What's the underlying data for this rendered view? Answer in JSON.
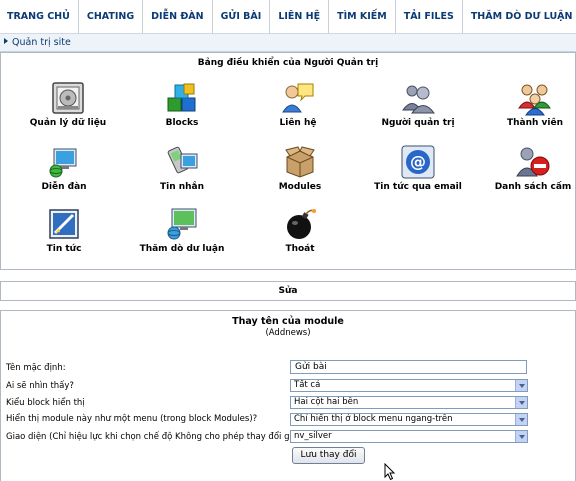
{
  "nav": {
    "items": [
      {
        "label": "TRANG CHỦ"
      },
      {
        "label": "CHATING"
      },
      {
        "label": "DIỄN ĐÀN"
      },
      {
        "label": "GỬI BÀI"
      },
      {
        "label": "LIÊN HỆ"
      },
      {
        "label": "TÌM KIẾM"
      },
      {
        "label": "TẢI FILES"
      },
      {
        "label": "THĂM DÒ DƯ LUẬN"
      }
    ]
  },
  "breadcrumb": {
    "label": "Quản trị site"
  },
  "panel": {
    "title": "Bảng điều khiển của Người Quản trị",
    "icons": [
      {
        "label": "Quản lý dữ liệu",
        "icon": "database-icon"
      },
      {
        "label": "Blocks",
        "icon": "blocks-icon"
      },
      {
        "label": "Liên hệ",
        "icon": "contact-icon"
      },
      {
        "label": "Người quản trị",
        "icon": "admin-users-icon"
      },
      {
        "label": "Thành viên",
        "icon": "members-icon"
      },
      {
        "label": "Diễn đàn",
        "icon": "forum-icon"
      },
      {
        "label": "Tin nhắn",
        "icon": "messages-icon"
      },
      {
        "label": "Modules",
        "icon": "modules-icon"
      },
      {
        "label": "Tin tức qua email",
        "icon": "email-news-icon"
      },
      {
        "label": "Danh sách cấm",
        "icon": "ban-list-icon"
      },
      {
        "label": "Tin tức",
        "icon": "news-icon"
      },
      {
        "label": "Thăm dò dư luận",
        "icon": "poll-icon"
      },
      {
        "label": "Thoát",
        "icon": "logout-bomb-icon"
      }
    ]
  },
  "editbar": {
    "label": "Sửa"
  },
  "rename": {
    "title": "Thay tên của module",
    "subtitle": "(Addnews)",
    "default_name_label": "Tên mặc định:",
    "default_name_value": "Gửi bài",
    "who_label": "Ai sẽ nhìn thấy?",
    "who_value": "Tất cả",
    "block_label": "Kiểu block hiển thị",
    "block_value": "Hai cột hai bên",
    "menu_label": "Hiển thị module này như một menu (trong block Modules)?",
    "menu_value": "Chỉ hiển thị ở block menu ngang-trên",
    "theme_label": "Giao diện (Chỉ hiệu lực khi chọn chế độ Không cho phép thay đổi giao diện)",
    "theme_value": "nv_silver",
    "save_label": "Lưu thay đổi"
  },
  "colors": {
    "nav_text": "#0b3a75",
    "border": "#b0b8c4",
    "dropdown": "#c3d3f7"
  }
}
